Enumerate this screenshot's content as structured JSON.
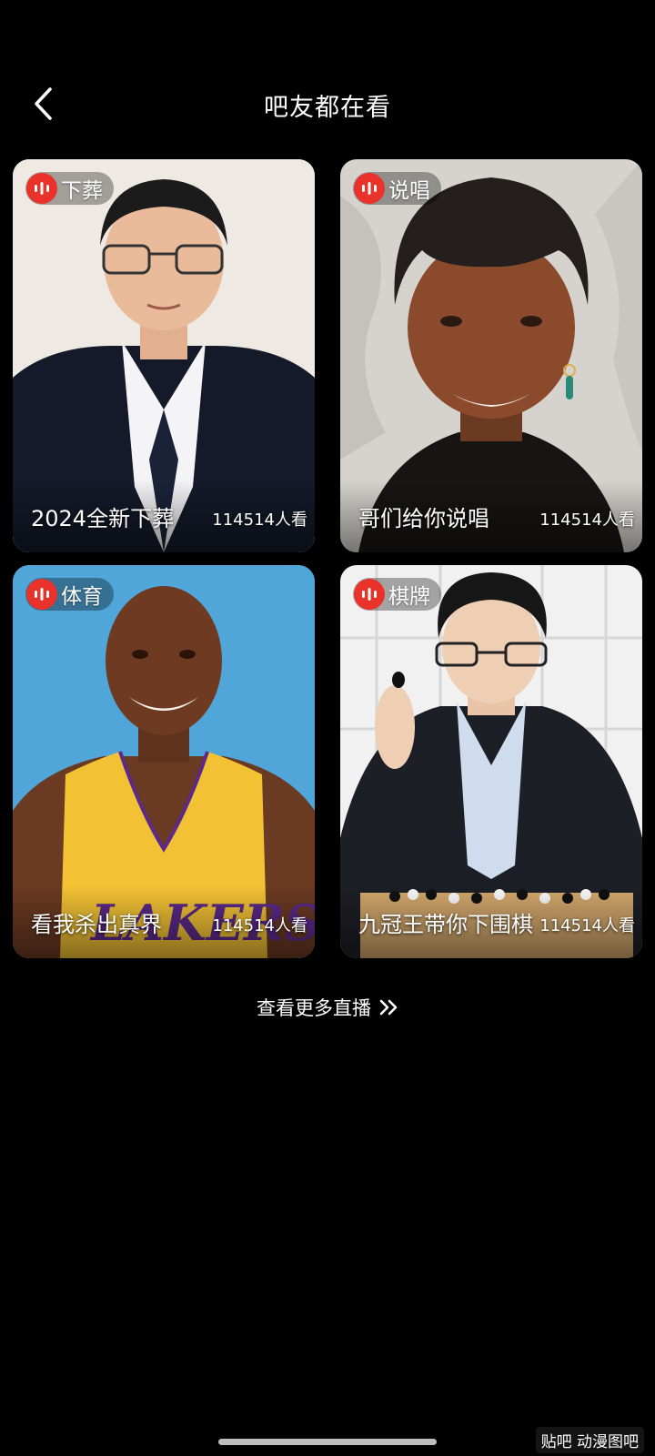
{
  "header": {
    "title": "吧友都在看"
  },
  "cards": [
    {
      "tag": "下葬",
      "title": "2024全新下葬",
      "views": "114514人看"
    },
    {
      "tag": "说唱",
      "title": "哥们给你说唱",
      "views": "114514人看"
    },
    {
      "tag": "体育",
      "title": "看我杀出真界",
      "views": "114514人看"
    },
    {
      "tag": "棋牌",
      "title": "九冠王带你下围棋",
      "views": "114514人看"
    }
  ],
  "more_link": "查看更多直播",
  "watermark": "贴吧 动漫图吧",
  "colors": {
    "background": "#000000",
    "tag_red": "#e8322a"
  }
}
